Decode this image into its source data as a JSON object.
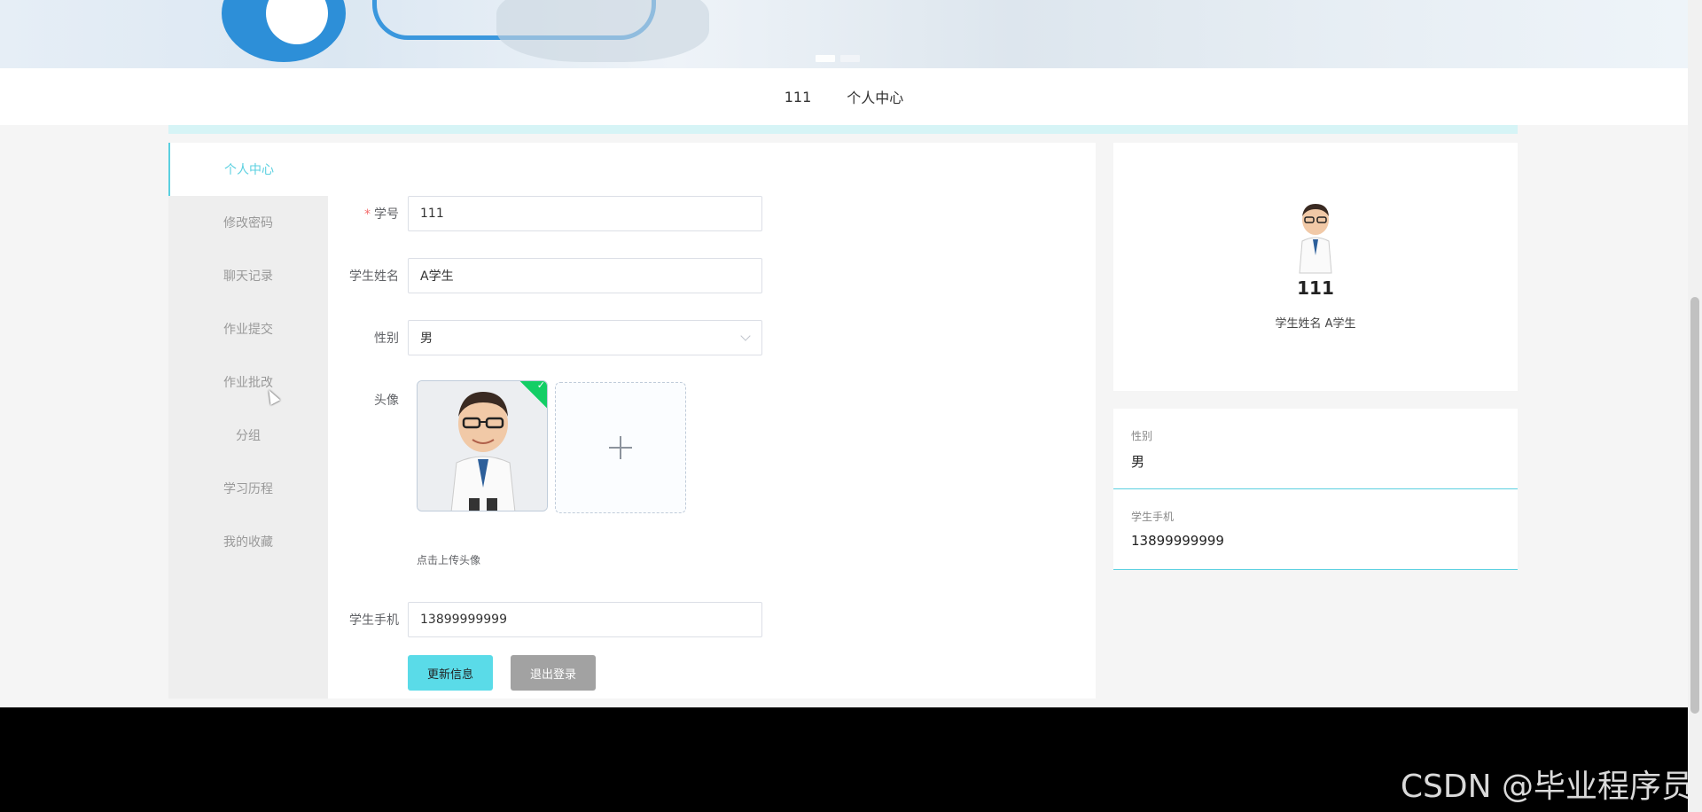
{
  "nav": {
    "items": [
      "111",
      "个人中心"
    ]
  },
  "sidebar": {
    "items": [
      "个人中心",
      "修改密码",
      "聊天记录",
      "作业提交",
      "作业批改",
      "分组",
      "学习历程",
      "我的收藏"
    ],
    "active": "个人中心"
  },
  "form": {
    "student_no": {
      "label": "学号",
      "value": "111"
    },
    "student_name": {
      "label": "学生姓名",
      "value": "A学生"
    },
    "gender": {
      "label": "性别",
      "value": "男"
    },
    "avatar": {
      "label": "头像",
      "hint": "点击上传头像"
    },
    "phone": {
      "label": "学生手机",
      "value": "13899999999"
    },
    "update_button": "更新信息",
    "logout_button": "退出登录"
  },
  "profile": {
    "username": "111",
    "name_line": "学生姓名 A学生"
  },
  "info": [
    {
      "label": "性别",
      "value": "男"
    },
    {
      "label": "学生手机",
      "value": "13899999999"
    }
  ],
  "watermark": "CSDN @毕业程序员",
  "colors": {
    "accent": "#5bd0e0",
    "update_button": "#5adbe8",
    "logout_button": "#a2a2a2",
    "success_badge": "#13ce66",
    "footer": "#000000"
  }
}
